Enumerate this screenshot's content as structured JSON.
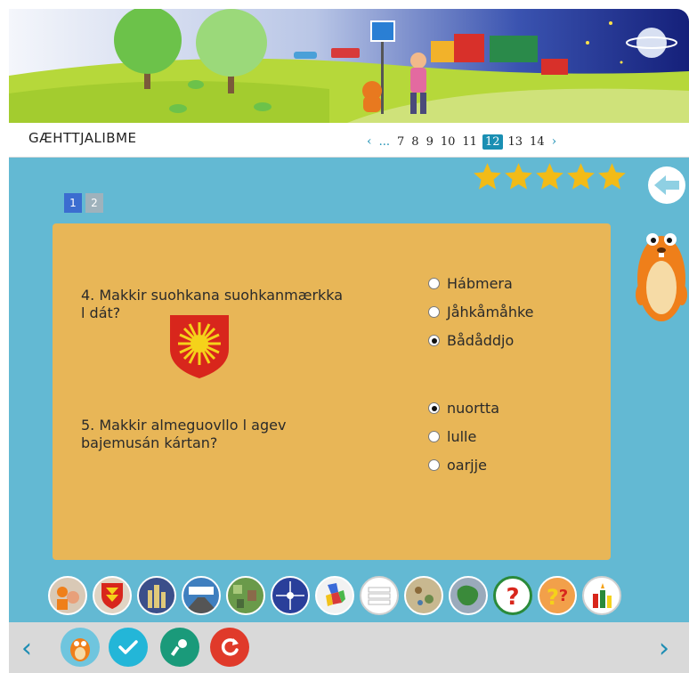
{
  "header": {
    "title": "GÆHTTJALIBME"
  },
  "pager": {
    "prev": "‹",
    "ellipsis": "...",
    "pages": [
      "7",
      "8",
      "9",
      "10",
      "11",
      "12",
      "13",
      "14"
    ],
    "active": "12",
    "next": "›"
  },
  "rating": {
    "stars": 5,
    "star_color": "#f2bb17"
  },
  "subtabs": [
    "1",
    "2"
  ],
  "questions": [
    {
      "line1": "4. Makkir suohkana suohkanmærkka",
      "line2": "l dát?",
      "options": [
        "Hábmera",
        "Jåhkåmåhke",
        "Bådåddjo"
      ],
      "selected": 2
    },
    {
      "line1": "5. Makkir almeguovllo l agev",
      "line2": "bajemusán kártan?",
      "options": [
        "nuortta",
        "lulle",
        "oarjje"
      ],
      "selected": 0
    }
  ],
  "colors": {
    "main_bg": "#63b9d3",
    "panel": "#e8b657",
    "accent": "#1a8fb3"
  },
  "toolbar": {
    "prev_arrow": "‹",
    "next_arrow": "›",
    "icons": [
      "map-people-icon",
      "coat-of-arms-icon",
      "city-icon",
      "road-sign-icon",
      "landscape-icon",
      "compass-icon",
      "colored-map-icon",
      "stripes-icon",
      "treasure-map-icon",
      "region-map-icon",
      "question-icon",
      "question-orange-icon",
      "candle-icon"
    ]
  }
}
